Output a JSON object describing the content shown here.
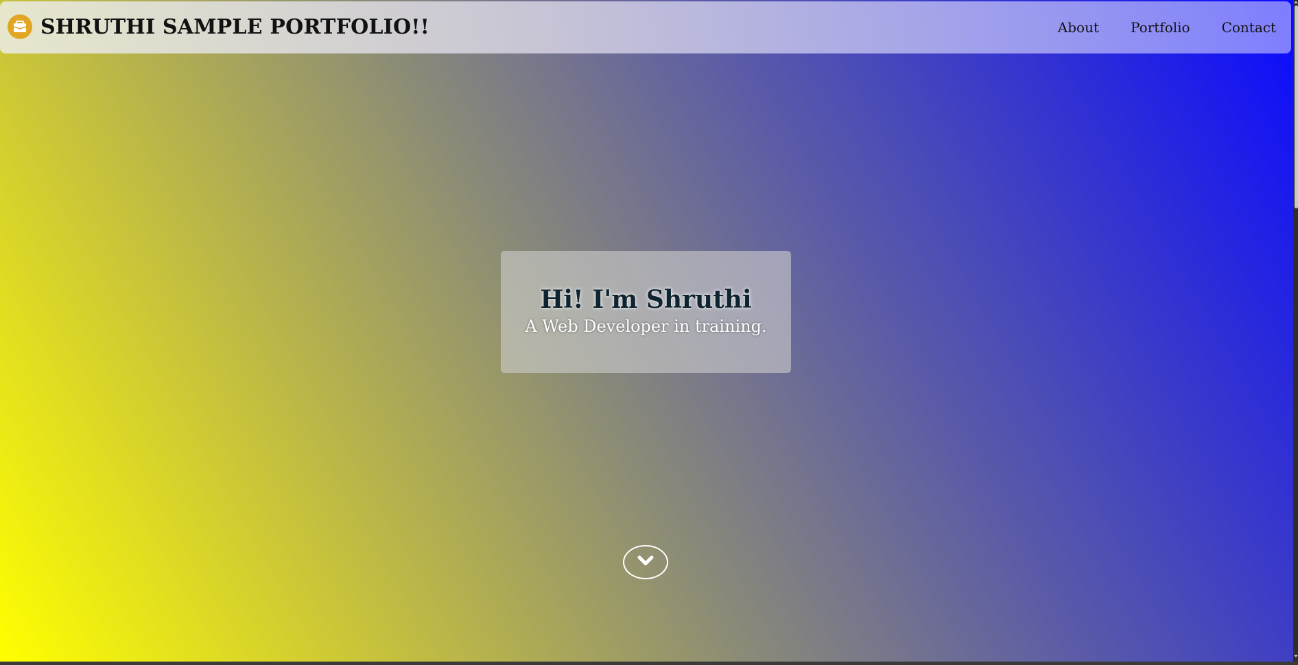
{
  "navbar": {
    "brand_icon": "briefcase-icon",
    "brand_title": "SHRUTHI SAMPLE PORTFOLIO!!",
    "links": [
      {
        "label": "About"
      },
      {
        "label": "Portfolio"
      },
      {
        "label": "Contact"
      }
    ]
  },
  "hero": {
    "title": "Hi! I'm Shruthi",
    "subtitle": "A Web Developer in training.",
    "scroll_icon": "chevron-down-icon"
  },
  "colors": {
    "gradient_start": "#ffff00",
    "gradient_end": "#0a0aff",
    "brand_icon_bg": "#e2a625",
    "hero_title": "#0e2430",
    "hero_subtitle": "#ffffff"
  }
}
